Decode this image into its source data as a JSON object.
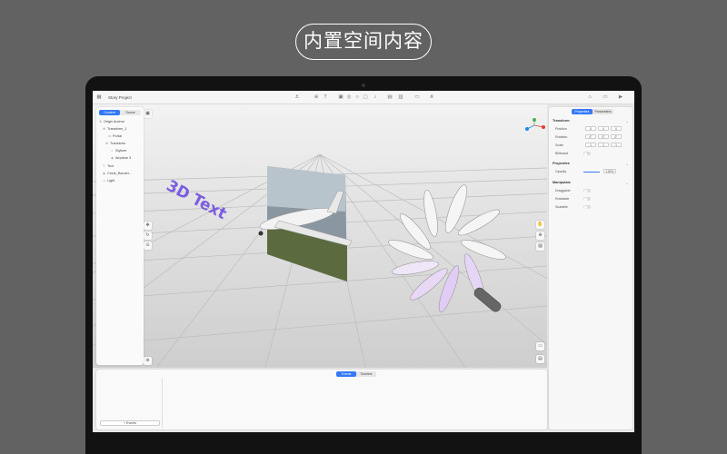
{
  "banner": {
    "text": "内置空间内容"
  },
  "app": {
    "title": "Story Project",
    "left_tabs": [
      {
        "label": "Content",
        "active": true
      },
      {
        "label": "Scene",
        "active": false
      }
    ],
    "tree": [
      {
        "label": "Origin Anchor",
        "icon": "anchor-icon"
      },
      {
        "label": "Transform_1",
        "icon": "transform-icon"
      },
      {
        "label": "Portal",
        "icon": "portal-icon"
      },
      {
        "label": "Transform",
        "icon": "transform-icon"
      },
      {
        "label": "Stylizer",
        "icon": "circle-icon"
      },
      {
        "label": "Airplane 3",
        "icon": "model-icon"
      },
      {
        "label": "Text",
        "icon": "text-icon"
      },
      {
        "label": "Circle_Banner...",
        "icon": "model-icon"
      },
      {
        "label": "Light",
        "icon": "light-icon"
      }
    ],
    "right_tabs": [
      {
        "label": "Properties",
        "active": true
      },
      {
        "label": "Parameters",
        "active": false
      }
    ],
    "transform": {
      "title": "Transform",
      "position_label": "Position",
      "position": [
        "0",
        "0",
        "0"
      ],
      "rotation_label": "Rotation",
      "rotation": [
        "0°",
        "0°",
        "0°"
      ],
      "scale_label": "Scale",
      "scale": [
        "1",
        "1",
        "1"
      ],
      "billboard_label": "Billboard"
    },
    "properties": {
      "title": "Properties",
      "opacity_label": "Opacity",
      "opacity_value": "100%"
    },
    "manipulate": {
      "title": "Manipulate",
      "draggable": "Draggable",
      "rotatable": "Rotatable",
      "scalable": "Scalable"
    },
    "bottom_tabs": [
      {
        "label": "Events",
        "active": true
      },
      {
        "label": "Timeline",
        "active": false
      }
    ],
    "add_events_label": "+ Events",
    "scene_text": "3D Text"
  },
  "colors": {
    "accent": "#3478f6",
    "text3d": "#7b5ce0",
    "banner_bg": "#626262"
  }
}
